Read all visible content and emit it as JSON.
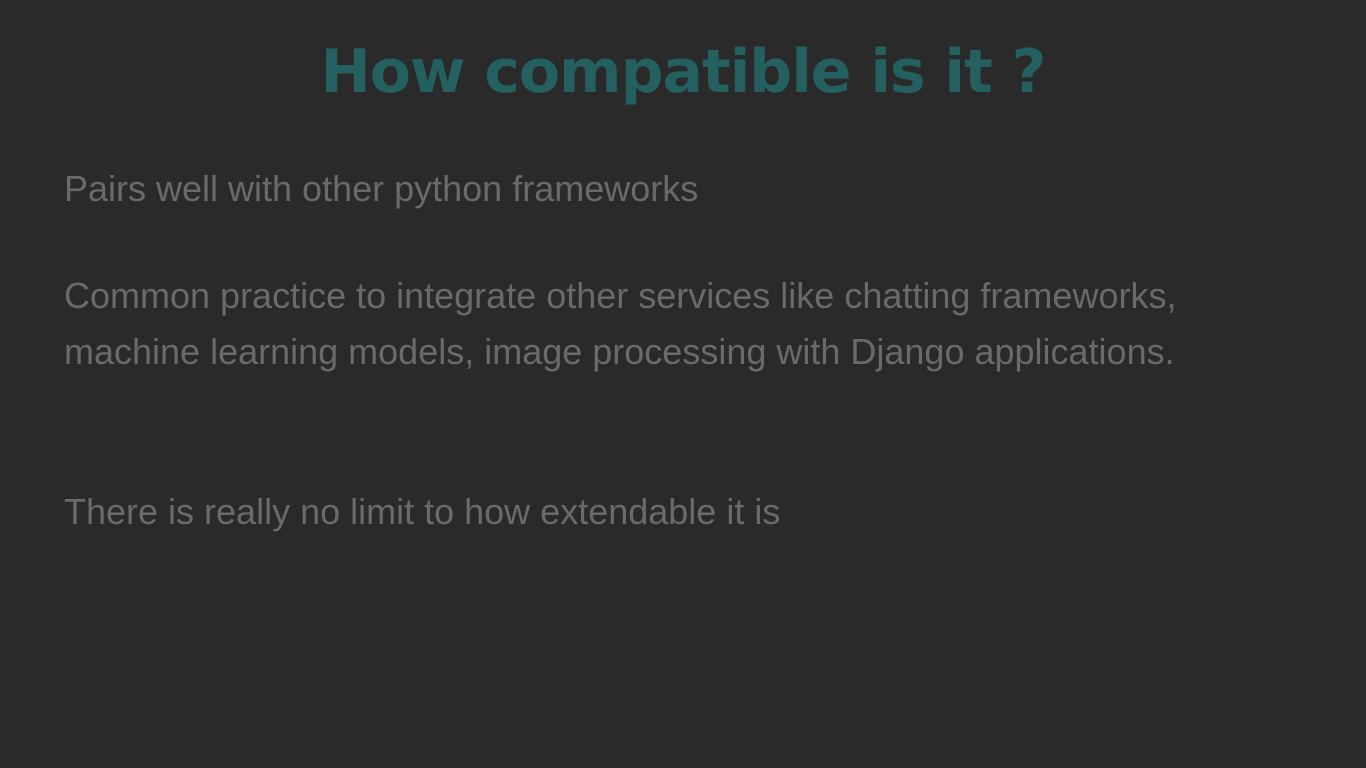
{
  "slide": {
    "title": "How compatible is it ?",
    "paragraphs": [
      "Pairs well with other python frameworks",
      "Common practice to integrate other services like chatting frameworks, machine learning models, image processing with Django applications.",
      "There is really no limit to how extendable it is"
    ]
  },
  "colors": {
    "background": "#2a2a2a",
    "title": "#24605f",
    "body_text": "#6a6a6a"
  }
}
